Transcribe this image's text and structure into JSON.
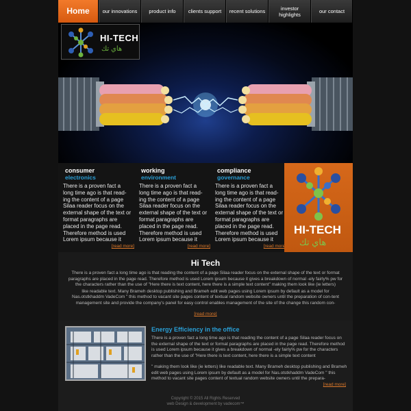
{
  "nav": {
    "home": "Home",
    "items": [
      "our innovations",
      "product info",
      "clients support",
      "recent solutions",
      "investor highlights",
      "our contact"
    ]
  },
  "logo": {
    "text": "HI-TECH",
    "arabic": "هاي تك"
  },
  "columns": [
    {
      "title": "consumer",
      "subtitle": "electronics",
      "text": "There is a proven fact a long time ago is that read-ing the content of a page Silaa reader focus on the external shape of the text or format paragraphs are placed in the page read. Therefore method is used Lorem ipsum because it",
      "more": "[read more]"
    },
    {
      "title": "working",
      "subtitle": "environment",
      "text": "There is a proven fact a long time ago is that read-ing the content of a page Silaa reader focus on the external shape of the text or format paragraphs are placed in the page read. Therefore method is used Lorem ipsum because it",
      "more": "[read more]"
    },
    {
      "title": "compliance",
      "subtitle": "governance",
      "text": "There is a proven fact a long time ago is that read-ing the content of a page Silaa reader focus on the external shape of the text or format paragraphs are placed in the page read. Therefore method is used Lorem ipsum because it",
      "more": "[read more]"
    }
  ],
  "hitech_box": {
    "text": "HI-TECH",
    "arabic": "هاي تك"
  },
  "about": {
    "title": "Hi Tech",
    "p1": "There is a proven fact a long time ago is that reading the content of a page Silaa reader focus on the external shape of the text or format paragraphs are placed in the page read. Therefore method is used Lorem ipsum because it gives a breakdown of normal -ely fairly% pw for the characters rather than the use of \"Here there is text content, here there is a simple text content\" making them look like (ie letters)",
    "p2": "like readable text. Many Brameh desktop publishing and Brameh edit web pages using Lorem ipsum by default as a model for Nas.otstkhaddm VadeCom \" this method to vacant site pages content of textual random website owners until the preparation of con-tent management site and provide the company's panel for easy control enables management of the site of the change this random con-",
    "more": "[read more]"
  },
  "energy": {
    "title": "Energy Efficiency in the  office",
    "p1": "There is a proven fact a long time ago is that reading the content of a page Silaa reader focus on the external shape of the text or format paragraphs are placed in the page read. Therefore method is used Lorem ipsum because it gives a breakdown of normal -ely fairly% pw for the characters rather than the use of \"Here there is text content, here there is a simple text content",
    "p2": "\" making them look like (ie letters) like readable text. Many Brameh desktop publishing and Brameh edit web pages using Lorem ipsum by default as a model for Nas.otstkhaddm VadeCom \" this method to vacant site pages content of textual random website owners until the prepara-",
    "more": "[read more]"
  },
  "footer": {
    "copyright": "Copyright © 2015 All Rights Reserved",
    "credit": "web Design & development by vadecom™"
  },
  "colors": {
    "accent": "#e07a2a",
    "link_blue": "#2a9fd6",
    "brand_green": "#6db33f"
  }
}
